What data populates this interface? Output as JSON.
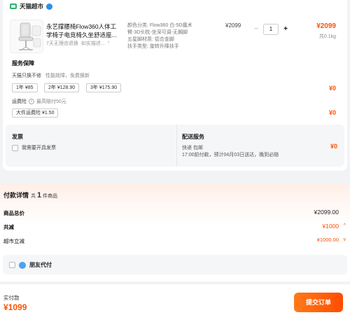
{
  "store": {
    "name": "天猫超市"
  },
  "product": {
    "title": "永艺撑腰椅Flow360人体工学椅子电竞椅久坐舒适座...",
    "sub_tags": [
      "7天无理由退换",
      "如实描述..."
    ],
    "specs": [
      "颜色分类: Flow360 白-5D魔术臂-3D头枕-坐深可调-无搁脚",
      "五星脚材质: 铝合金脚",
      "扶手类型: 旋转升降扶手"
    ],
    "unit_price": "¥2099",
    "quantity": "1",
    "minus": "−",
    "plus": "+",
    "line_total": "¥2099",
    "weight": "共0.1kg"
  },
  "service": {
    "title": "服务保障",
    "desc_main": "天猫只换不修",
    "desc_sub": "性能故障，免费换新",
    "options": [
      "1年 ¥85",
      "2年 ¥128.90",
      "3年 ¥175.90"
    ],
    "price": "¥0"
  },
  "return_shipping": {
    "label": "运费险",
    "info": "i",
    "sub": "最高赔付50元",
    "chip": "大件运费险 ¥1.50",
    "price": "¥0"
  },
  "invoice": {
    "title": "发票",
    "checkbox_label": "我需要开具发票"
  },
  "delivery": {
    "title": "配送服务",
    "line1": "快递 包邮",
    "line2": "17:00前付款，预计04月03日送达，晚到必赔",
    "price": "¥0"
  },
  "payment": {
    "title": "付款详情",
    "count_prefix": "共",
    "count": "1",
    "count_suffix": "件商品",
    "rows": [
      {
        "label": "商品总价",
        "value": "¥2099.00"
      },
      {
        "label": "共减",
        "value": "¥1000",
        "chevron": "^"
      },
      {
        "label": "超市立减",
        "value": "¥1000.00",
        "chevron": "v"
      }
    ],
    "friend_pay": "朋友代付"
  },
  "footer": {
    "pay_label": "实付款",
    "pay_amount": "¥1099",
    "submit": "提交订单"
  },
  "colors": {
    "accent": "#ff5000",
    "store_green": "#2fb36b",
    "info_blue": "#2b8fe8"
  }
}
